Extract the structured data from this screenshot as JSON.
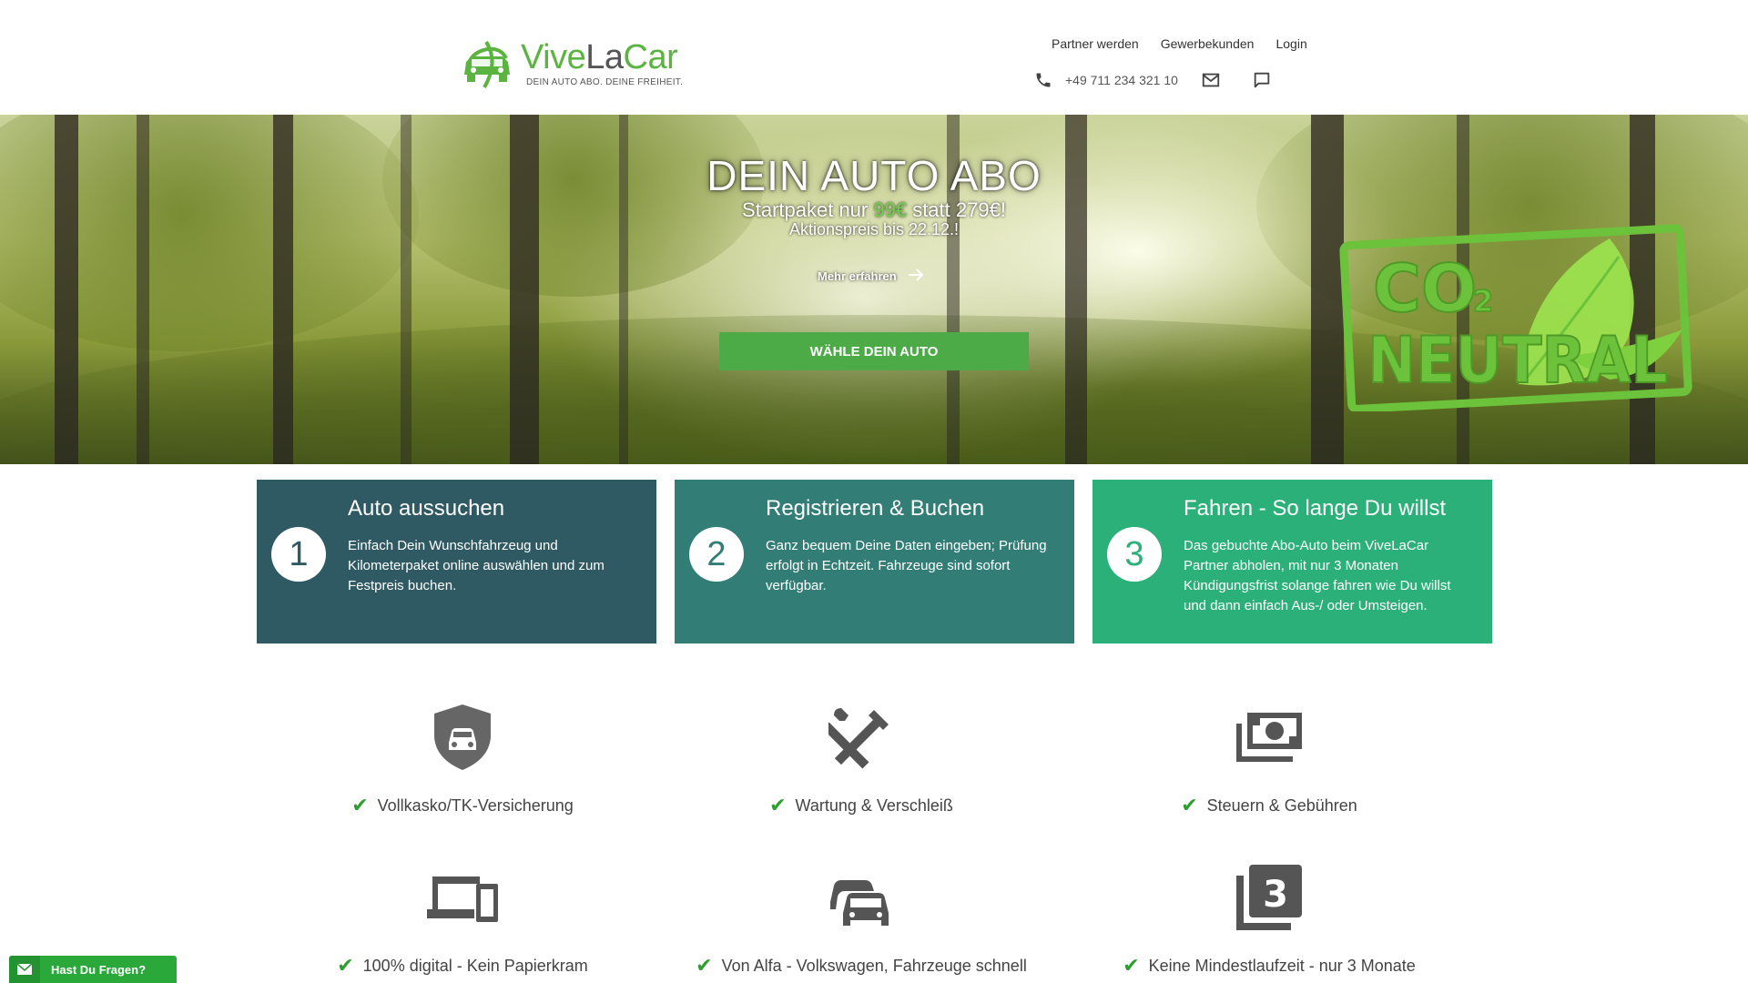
{
  "brand": {
    "name_part1": "Vive",
    "name_part2": "La",
    "name_part3": "Car",
    "tagline": "DEIN AUTO ABO. DEINE FREIHEIT.",
    "color_green": "#5cb440",
    "color_gray": "#555555"
  },
  "nav": {
    "items": [
      {
        "label": "Partner werden"
      },
      {
        "label": "Gewerbekunden"
      },
      {
        "label": "Login"
      }
    ],
    "phone": "+49 711 234 321 10"
  },
  "hero": {
    "title": "DEIN AUTO ABO",
    "sub_prefix": "Startpaket nur ",
    "sub_price": "99€",
    "sub_suffix": " statt 279€!",
    "promo": "Aktionspreis bis 22.12.!",
    "more_link": "Mehr erfahren",
    "cta": "WÄHLE DEIN AUTO",
    "badge_line1": "CO",
    "badge_sub": "2",
    "badge_line2": "NEUTRAL"
  },
  "steps": [
    {
      "number": "1",
      "title": "Auto aussuchen",
      "text": "Einfach Dein Wunschfahrzeug und Kilometerpaket online auswählen und zum Festpreis buchen.",
      "color": "#305a63"
    },
    {
      "number": "2",
      "title": "Registrieren & Buchen",
      "text": "Ganz bequem Deine Daten eingeben; Prüfung erfolgt in Echtzeit. Fahrzeuge sind sofort verfügbar.",
      "color": "#327e77"
    },
    {
      "number": "3",
      "title": "Fahren - So lange Du willst",
      "text": "Das gebuchte Abo-Auto beim ViveLaCar Partner abholen, mit nur 3 Monaten Kündigungsfrist solange fahren wie Du willst und dann einfach Aus-/ oder Umsteigen.",
      "color": "#2bb07a"
    }
  ],
  "features": [
    {
      "icon": "shield-car-icon",
      "label": "Vollkasko/TK-Versicherung"
    },
    {
      "icon": "tools-icon",
      "label": "Wartung & Verschleiß"
    },
    {
      "icon": "money-icon",
      "label": "Steuern & Gebühren"
    },
    {
      "icon": "devices-icon",
      "label": "100% digital - Kein Papierkram"
    },
    {
      "icon": "cars-icon",
      "label": "Von Alfa - Volkswagen, Fahrzeuge schnell"
    },
    {
      "icon": "number-3-icon",
      "label": "Keine Mindestlaufzeit - nur 3 Monate"
    }
  ],
  "chat": {
    "label": "Hast Du Fragen?"
  }
}
